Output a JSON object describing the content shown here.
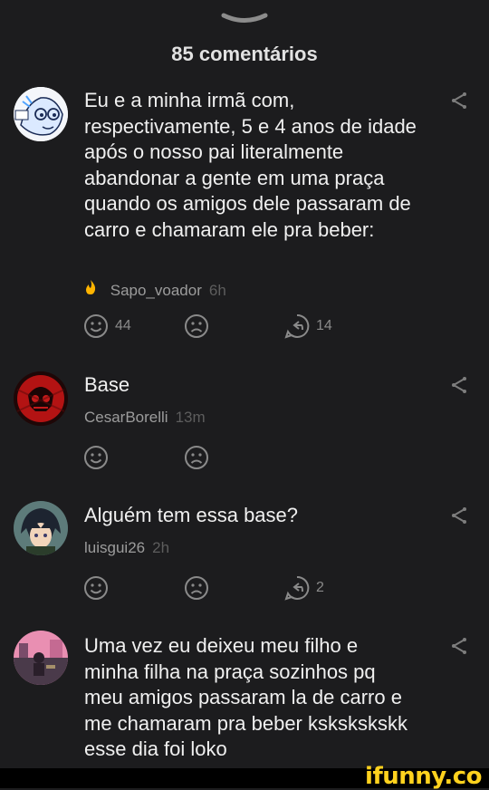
{
  "header": {
    "title": "85 comentários",
    "handle_icon": "chevron-down-icon"
  },
  "colors": {
    "background": "#1c1c1e",
    "text": "#f0f0f0",
    "muted": "#9c9c9c",
    "icon": "#8a8a8a",
    "brand": "#ffd21e"
  },
  "comments": [
    {
      "text": "Eu e a minha irmã com, respectivamente, 5 e 4 anos de idade após o nosso pai literalmente abandonar a gente em uma praça quando os amigos dele passaram de carro e chamaram ele pra beber:",
      "user": "Sapo_voador",
      "time": "6h",
      "badge_icon": "flame-icon",
      "likes": "44",
      "replies": "14"
    },
    {
      "text": "Base",
      "user": "CesarBorelli",
      "time": "13m",
      "likes": "",
      "replies": ""
    },
    {
      "text": "Alguém tem essa base?",
      "user": "luisgui26",
      "time": "2h",
      "likes": "",
      "replies": "2"
    },
    {
      "text": "Uma vez eu deixeu meu filho e minha filha na praça sozinhos pq meu amigos passaram la de carro e me chamaram pra beber kskskskskk esse dia foi loko"
    }
  ],
  "footer": {
    "brand": "ifunny.co"
  }
}
